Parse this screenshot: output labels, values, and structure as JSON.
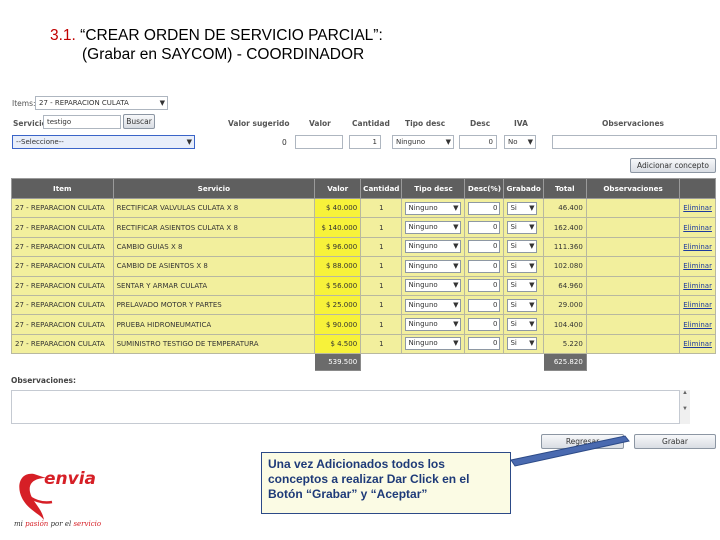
{
  "slide": {
    "title_num": "3.1.",
    "title_main": " “CREAR ORDEN DE SERVICIO PARCIAL”:",
    "title_line2": "(Grabar en SAYCOM) - COORDINADOR"
  },
  "form": {
    "items_label": "Items:",
    "items_value": "27 - REPARACION CULATA",
    "servicio_label": "Servicio",
    "servicio_value": "testigo",
    "buscar_label": "Buscar",
    "servicio_select": "--Seleccione--",
    "valor_sugerido_label": "Valor sugerido",
    "valor_sugerido_value": "0",
    "valor_label": "Valor",
    "cantidad_label": "Cantidad",
    "cantidad_value": "1",
    "tipo_desc_label": "Tipo desc",
    "tipo_desc_value": "Ninguno",
    "desc_label": "Desc",
    "desc_value": "0",
    "iva_label": "IVA",
    "iva_value": "No",
    "observaciones_label": "Observaciones",
    "adicionar_label": "Adicionar concepto"
  },
  "grid": {
    "headers": [
      "Item",
      "Servicio",
      "Valor",
      "Cantidad",
      "Tipo desc",
      "Desc(%)",
      "Grabado",
      "Total",
      "Observaciones",
      ""
    ],
    "rows": [
      {
        "item": "27 - REPARACION CULATA",
        "servicio": "RECTIFICAR VALVULAS CULATA X 8",
        "valor": "$ 40.000",
        "cantidad": "1",
        "tipo": "Ninguno",
        "desc": "0",
        "grabado": "Si",
        "total": "46.400",
        "action": "Eliminar"
      },
      {
        "item": "27 - REPARACION CULATA",
        "servicio": "RECTIFICAR ASIENTOS CULATA X 8",
        "valor": "$ 140.000",
        "cantidad": "1",
        "tipo": "Ninguno",
        "desc": "0",
        "grabado": "Si",
        "total": "162.400",
        "action": "Eliminar"
      },
      {
        "item": "27 - REPARACION CULATA",
        "servicio": "CAMBIO GUIAS X 8",
        "valor": "$ 96.000",
        "cantidad": "1",
        "tipo": "Ninguno",
        "desc": "0",
        "grabado": "Si",
        "total": "111.360",
        "action": "Eliminar"
      },
      {
        "item": "27 - REPARACION CULATA",
        "servicio": "CAMBIO DE ASIENTOS X 8",
        "valor": "$ 88.000",
        "cantidad": "1",
        "tipo": "Ninguno",
        "desc": "0",
        "grabado": "Si",
        "total": "102.080",
        "action": "Eliminar"
      },
      {
        "item": "27 - REPARACION CULATA",
        "servicio": "SENTAR Y ARMAR CULATA",
        "valor": "$ 56.000",
        "cantidad": "1",
        "tipo": "Ninguno",
        "desc": "0",
        "grabado": "Si",
        "total": "64.960",
        "action": "Eliminar"
      },
      {
        "item": "27 - REPARACION CULATA",
        "servicio": "PRELAVADO MOTOR Y PARTES",
        "valor": "$ 25.000",
        "cantidad": "1",
        "tipo": "Ninguno",
        "desc": "0",
        "grabado": "Si",
        "total": "29.000",
        "action": "Eliminar"
      },
      {
        "item": "27 - REPARACION CULATA",
        "servicio": "PRUEBA HIDRONEUMATICA",
        "valor": "$ 90.000",
        "cantidad": "1",
        "tipo": "Ninguno",
        "desc": "0",
        "grabado": "Si",
        "total": "104.400",
        "action": "Eliminar"
      },
      {
        "item": "27 - REPARACION CULATA",
        "servicio": "SUMINISTRO TESTIGO DE TEMPERATURA",
        "valor": "$ 4.500",
        "cantidad": "1",
        "tipo": "Ninguno",
        "desc": "0",
        "grabado": "Si",
        "total": "5.220",
        "action": "Eliminar"
      }
    ],
    "sum_valor": "539.500",
    "sum_total": "625.820"
  },
  "bottom": {
    "observaciones_label": "Observaciones:",
    "regresar_label": "Regresar",
    "grabar_label": "Grabar"
  },
  "callout": {
    "text": "Una vez Adicionados todos los conceptos a realizar Dar Click en el Botón “Grabar” y “Aceptar”"
  },
  "logo": {
    "brand": "envia",
    "tagline": "mi pasión por el servicio"
  },
  "colors": {
    "title_num": "#c00000",
    "header_bg": "#5f5f5f",
    "row_bg": "#f2ef9d",
    "valor_bg": "#f7f23a",
    "callout_border": "#2c4a87",
    "brand_red": "#d61f26"
  }
}
